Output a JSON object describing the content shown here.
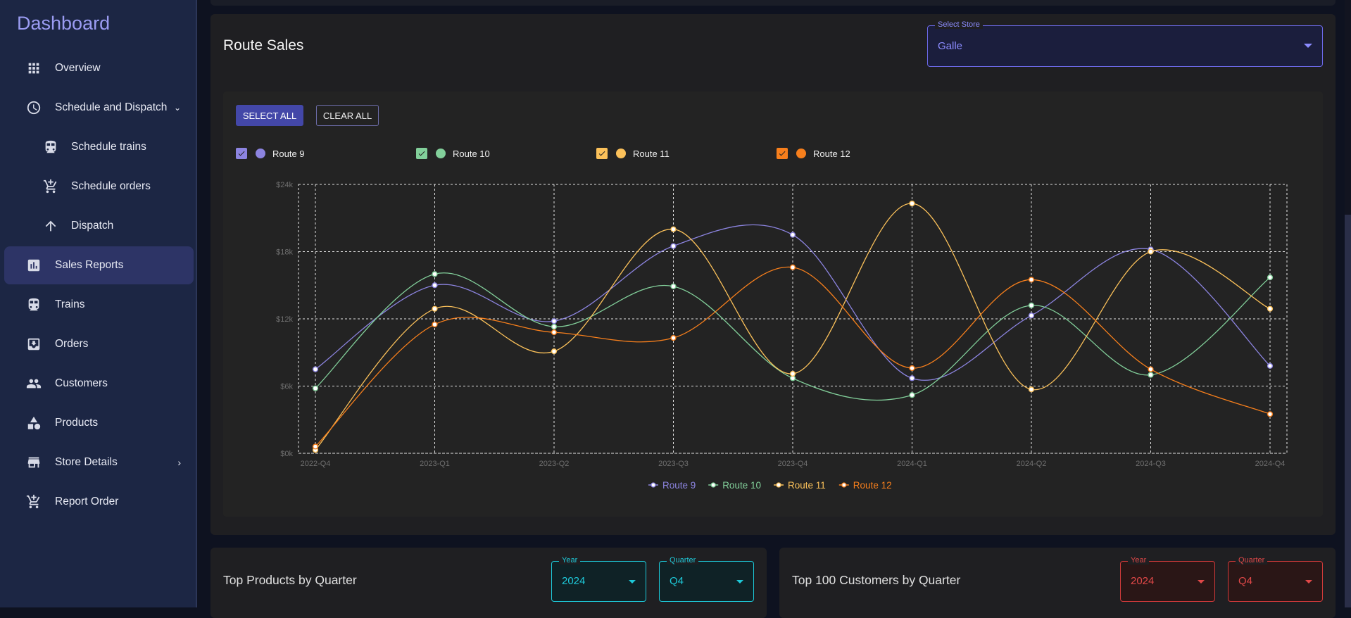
{
  "sidebar": {
    "title": "Dashboard",
    "items": [
      {
        "label": "Overview",
        "icon": "grid-icon"
      },
      {
        "label": "Schedule and Dispatch",
        "icon": "clock-icon"
      },
      {
        "label": "Schedule trains",
        "icon": "train-icon"
      },
      {
        "label": "Schedule orders",
        "icon": "cart-add-icon"
      },
      {
        "label": "Dispatch",
        "icon": "arrow-up-icon"
      },
      {
        "label": "Sales Reports",
        "icon": "bar-chart-icon"
      },
      {
        "label": "Trains",
        "icon": "train-icon"
      },
      {
        "label": "Orders",
        "icon": "inbox-icon"
      },
      {
        "label": "Customers",
        "icon": "people-icon"
      },
      {
        "label": "Products",
        "icon": "category-icon"
      },
      {
        "label": "Store Details",
        "icon": "store-icon"
      },
      {
        "label": "Report Order",
        "icon": "cart-icon"
      }
    ],
    "active": "Sales Reports"
  },
  "route_sales": {
    "title": "Route Sales",
    "store_select": {
      "label": "Select Store",
      "value": "Galle"
    },
    "buttons": {
      "select_all": "SELECT ALL",
      "clear_all": "CLEAR ALL"
    },
    "toggles": [
      {
        "label": "Route 9",
        "checked": true,
        "color": "#8c84e0"
      },
      {
        "label": "Route 10",
        "checked": true,
        "color": "#82cf9a"
      },
      {
        "label": "Route 11",
        "checked": true,
        "color": "#fbc15a"
      },
      {
        "label": "Route 12",
        "checked": true,
        "color": "#f77f1c"
      }
    ]
  },
  "chart_data": {
    "type": "line",
    "x": [
      "2022-Q4",
      "2023-Q1",
      "2023-Q2",
      "2023-Q3",
      "2023-Q4",
      "2024-Q1",
      "2024-Q2",
      "2024-Q3",
      "2024-Q4"
    ],
    "y_ticks": [
      "$0k",
      "$6k",
      "$12k",
      "$18k",
      "$24k"
    ],
    "ylim": [
      0,
      24000
    ],
    "grid": true,
    "legend_position": "bottom",
    "series": [
      {
        "name": "Route 9",
        "color": "#8c84e0",
        "values": [
          7500,
          15000,
          11800,
          18500,
          19500,
          6700,
          12300,
          18200,
          7800
        ]
      },
      {
        "name": "Route 10",
        "color": "#82cf9a",
        "values": [
          5800,
          16000,
          11300,
          14900,
          6700,
          5200,
          13200,
          7000,
          15700
        ]
      },
      {
        "name": "Route 11",
        "color": "#fbc15a",
        "values": [
          300,
          12900,
          9100,
          20000,
          7100,
          22300,
          5700,
          18000,
          12900
        ]
      },
      {
        "name": "Route 12",
        "color": "#f77f1c",
        "values": [
          600,
          11500,
          10800,
          10300,
          16600,
          7600,
          15500,
          7500,
          3500
        ]
      }
    ]
  },
  "top_products": {
    "title": "Top Products by Quarter",
    "year": {
      "label": "Year",
      "value": "2024"
    },
    "quarter": {
      "label": "Quarter",
      "value": "Q4"
    }
  },
  "top_customers": {
    "title": "Top 100 Customers by Quarter",
    "year": {
      "label": "Year",
      "value": "2024"
    },
    "quarter": {
      "label": "Quarter",
      "value": "Q4"
    }
  }
}
